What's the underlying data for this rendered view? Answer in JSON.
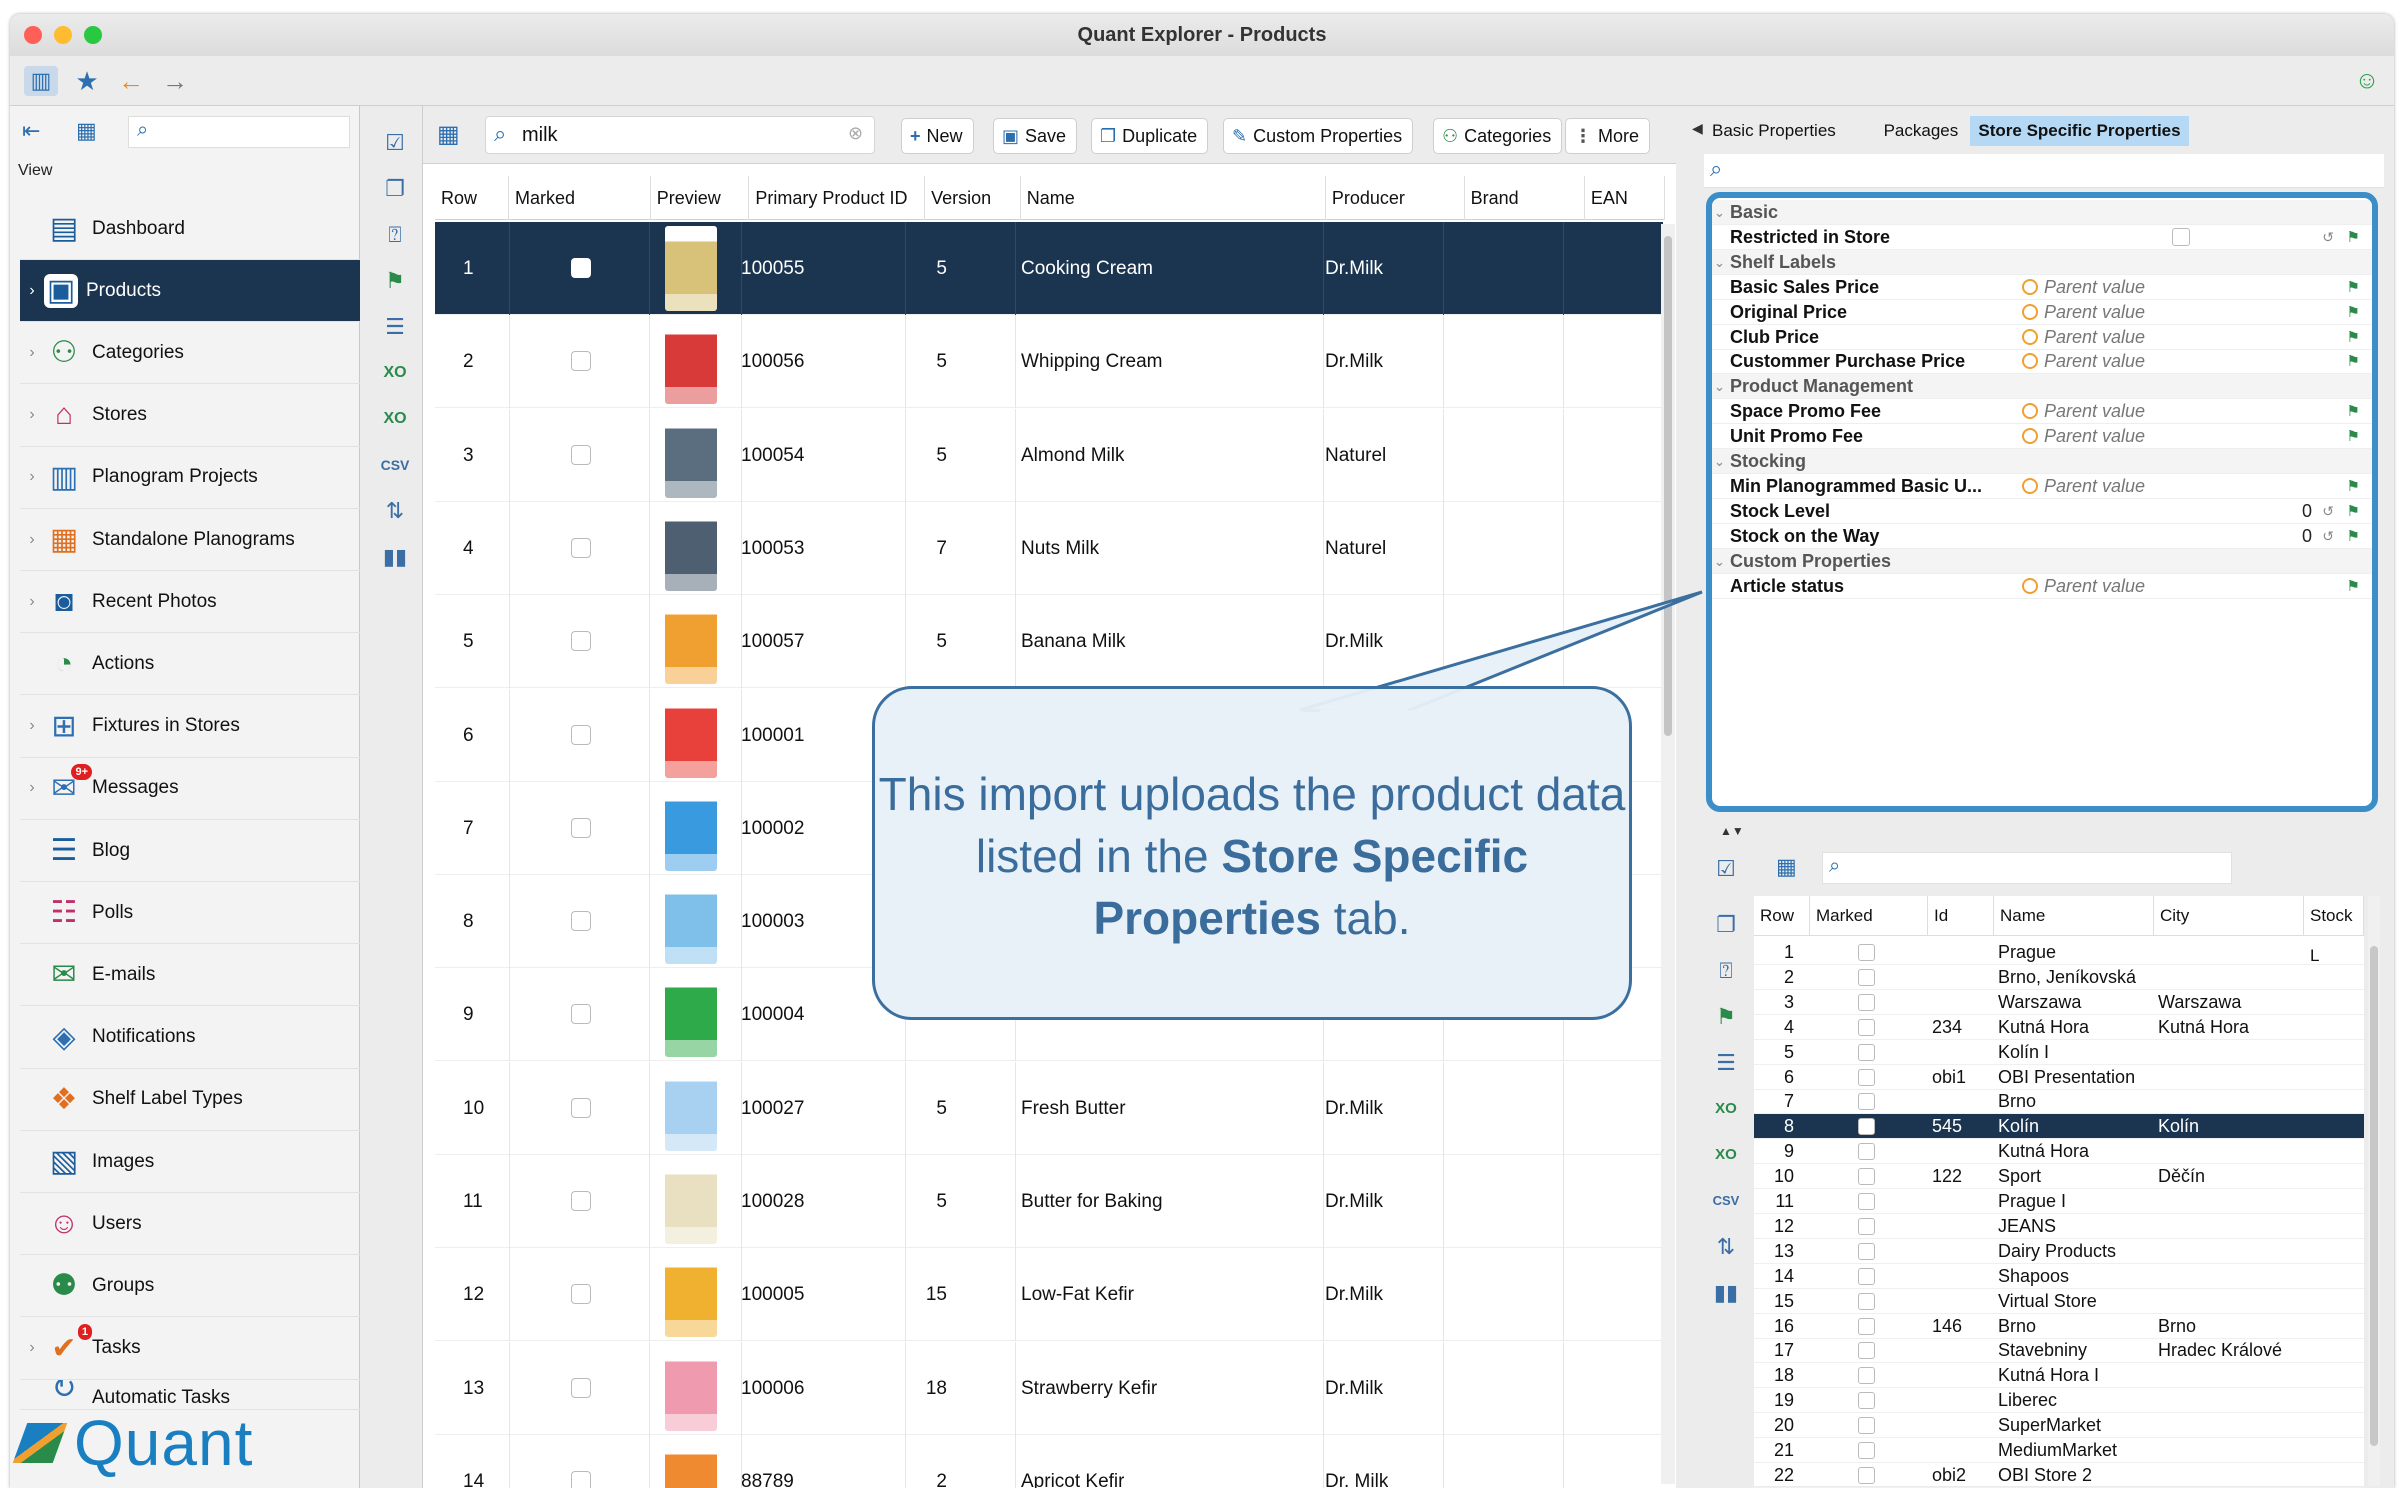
{
  "window": {
    "title": "Quant Explorer - Products"
  },
  "sidebar": {
    "section_label": "View",
    "items": [
      {
        "label": "Dashboard",
        "icon": "dashboard-icon",
        "chevron": false
      },
      {
        "label": "Products",
        "icon": "products-icon",
        "chevron": true,
        "active": true
      },
      {
        "label": "Categories",
        "icon": "categories-icon",
        "chevron": true
      },
      {
        "label": "Stores",
        "icon": "stores-icon",
        "chevron": true
      },
      {
        "label": "Planogram Projects",
        "icon": "planogram-projects-icon",
        "chevron": true
      },
      {
        "label": "Standalone Planograms",
        "icon": "standalone-planograms-icon",
        "chevron": true
      },
      {
        "label": "Recent Photos",
        "icon": "camera-icon",
        "chevron": true
      },
      {
        "label": "Actions",
        "icon": "actions-icon",
        "chevron": false
      },
      {
        "label": "Fixtures in Stores",
        "icon": "fixtures-icon",
        "chevron": true
      },
      {
        "label": "Messages",
        "icon": "messages-icon",
        "chevron": true,
        "badge": "9+"
      },
      {
        "label": "Blog",
        "icon": "blog-icon",
        "chevron": false
      },
      {
        "label": "Polls",
        "icon": "polls-icon",
        "chevron": false
      },
      {
        "label": "E-mails",
        "icon": "email-icon",
        "chevron": false
      },
      {
        "label": "Notifications",
        "icon": "notifications-icon",
        "chevron": false
      },
      {
        "label": "Shelf Label Types",
        "icon": "shelf-label-icon",
        "chevron": false
      },
      {
        "label": "Images",
        "icon": "images-icon",
        "chevron": false
      },
      {
        "label": "Users",
        "icon": "users-icon",
        "chevron": false
      },
      {
        "label": "Groups",
        "icon": "groups-icon",
        "chevron": false
      },
      {
        "label": "Tasks",
        "icon": "tasks-icon",
        "chevron": true,
        "badge": "1"
      },
      {
        "label": "Automatic Tasks",
        "icon": "automatic-tasks-icon",
        "chevron": false
      }
    ],
    "logo_text": "Quant"
  },
  "main": {
    "search_value": "milk",
    "buttons": {
      "new": "New",
      "save": "Save",
      "duplicate": "Duplicate",
      "custom_properties": "Custom Properties",
      "categories": "Categories",
      "more": "More"
    },
    "columns": [
      "Row",
      "Marked",
      "Preview",
      "Primary Product ID",
      "Version",
      "Name",
      "Producer",
      "Brand",
      "EAN"
    ],
    "rows": [
      {
        "row": "1",
        "id": "100055",
        "version": "5",
        "name": "Cooking Cream",
        "producer": "Dr.Milk",
        "color": "#d8c27a"
      },
      {
        "row": "2",
        "id": "100056",
        "version": "5",
        "name": "Whipping Cream",
        "producer": "Dr.Milk",
        "color": "#d83a3a"
      },
      {
        "row": "3",
        "id": "100054",
        "version": "5",
        "name": "Almond Milk",
        "producer": "Naturel",
        "color": "#5b6e80"
      },
      {
        "row": "4",
        "id": "100053",
        "version": "7",
        "name": "Nuts Milk",
        "producer": "Naturel",
        "color": "#4e5f72"
      },
      {
        "row": "5",
        "id": "100057",
        "version": "5",
        "name": "Banana Milk",
        "producer": "Dr.Milk",
        "color": "#f0a030"
      },
      {
        "row": "6",
        "id": "100001",
        "version": "",
        "name": "",
        "producer": "",
        "color": "#e8403a"
      },
      {
        "row": "7",
        "id": "100002",
        "version": "",
        "name": "",
        "producer": "",
        "color": "#3a9ae0"
      },
      {
        "row": "8",
        "id": "100003",
        "version": "",
        "name": "",
        "producer": "",
        "color": "#7ec0ea"
      },
      {
        "row": "9",
        "id": "100004",
        "version": "",
        "name": "",
        "producer": "",
        "color": "#2eaa4a"
      },
      {
        "row": "10",
        "id": "100027",
        "version": "5",
        "name": "Fresh Butter",
        "producer": "Dr.Milk",
        "color": "#a8d0f0"
      },
      {
        "row": "11",
        "id": "100028",
        "version": "5",
        "name": "Butter for Baking",
        "producer": "Dr.Milk",
        "color": "#e8e0c0"
      },
      {
        "row": "12",
        "id": "100005",
        "version": "15",
        "name": "Low-Fat Kefir",
        "producer": "Dr.Milk",
        "color": "#f0b030"
      },
      {
        "row": "13",
        "id": "100006",
        "version": "18",
        "name": "Strawberry Kefir",
        "producer": "Dr.Milk",
        "color": "#f09ab0"
      },
      {
        "row": "14",
        "id": "88789",
        "version": "2",
        "name": "Apricot Kefir",
        "producer": "Dr. Milk",
        "color": "#f08a30"
      }
    ]
  },
  "right": {
    "tabs": [
      "Basic Properties",
      "Packages",
      "Store Specific Properties"
    ],
    "properties": [
      {
        "group": "Basic"
      },
      {
        "name": "Restricted in Store",
        "type": "checkbox"
      },
      {
        "group": "Shelf Labels"
      },
      {
        "name": "Basic Sales Price",
        "value": "Parent value"
      },
      {
        "name": "Original Price",
        "value": "Parent value"
      },
      {
        "name": "Club Price",
        "value": "Parent value"
      },
      {
        "name": "Custommer Purchase Price",
        "value": "Parent value"
      },
      {
        "group": "Product Management"
      },
      {
        "name": "Space Promo Fee",
        "value": "Parent value"
      },
      {
        "name": "Unit Promo Fee",
        "value": "Parent value"
      },
      {
        "group": "Stocking"
      },
      {
        "name": "Min Planogrammed Basic U...",
        "value": "Parent value"
      },
      {
        "name": "Stock Level",
        "number": "0"
      },
      {
        "name": "Stock on the Way",
        "number": "0"
      },
      {
        "group": "Custom Properties"
      },
      {
        "name": "Article status",
        "value": "Parent value"
      }
    ],
    "store_columns": [
      "Row",
      "Marked",
      "Id",
      "Name",
      "City",
      "Stock L"
    ],
    "stores": [
      {
        "row": "1",
        "id": "",
        "name": "Prague",
        "city": ""
      },
      {
        "row": "2",
        "id": "",
        "name": "Brno, Jeníkovská",
        "city": ""
      },
      {
        "row": "3",
        "id": "",
        "name": "Warszawa",
        "city": "Warszawa"
      },
      {
        "row": "4",
        "id": "234",
        "name": "Kutná Hora",
        "city": "Kutná Hora"
      },
      {
        "row": "5",
        "id": "",
        "name": "Kolín I",
        "city": ""
      },
      {
        "row": "6",
        "id": "obi1",
        "name": "OBI Presentation",
        "city": ""
      },
      {
        "row": "7",
        "id": "",
        "name": "Brno",
        "city": ""
      },
      {
        "row": "8",
        "id": "545",
        "name": "Kolín",
        "city": "Kolín",
        "selected": true
      },
      {
        "row": "9",
        "id": "",
        "name": "Kutná Hora",
        "city": ""
      },
      {
        "row": "10",
        "id": "122",
        "name": "Sport",
        "city": "Děčín"
      },
      {
        "row": "11",
        "id": "",
        "name": "Prague I",
        "city": ""
      },
      {
        "row": "12",
        "id": "",
        "name": "JEANS",
        "city": ""
      },
      {
        "row": "13",
        "id": "",
        "name": "Dairy Products",
        "city": ""
      },
      {
        "row": "14",
        "id": "",
        "name": "Shapoos",
        "city": ""
      },
      {
        "row": "15",
        "id": "",
        "name": "Virtual Store",
        "city": ""
      },
      {
        "row": "16",
        "id": "146",
        "name": "Brno",
        "city": "Brno"
      },
      {
        "row": "17",
        "id": "",
        "name": "Stavebniny",
        "city": "Hradec Králové"
      },
      {
        "row": "18",
        "id": "",
        "name": "Kutná Hora I",
        "city": ""
      },
      {
        "row": "19",
        "id": "",
        "name": "Liberec",
        "city": ""
      },
      {
        "row": "20",
        "id": "",
        "name": "SuperMarket",
        "city": ""
      },
      {
        "row": "21",
        "id": "",
        "name": "MediumMarket",
        "city": ""
      },
      {
        "row": "22",
        "id": "obi2",
        "name": "OBI Store 2",
        "city": ""
      }
    ]
  },
  "callout": {
    "text_1": "This import uploads the product data listed in the ",
    "text_bold": "Store Specific Properties",
    "text_2": " tab."
  }
}
